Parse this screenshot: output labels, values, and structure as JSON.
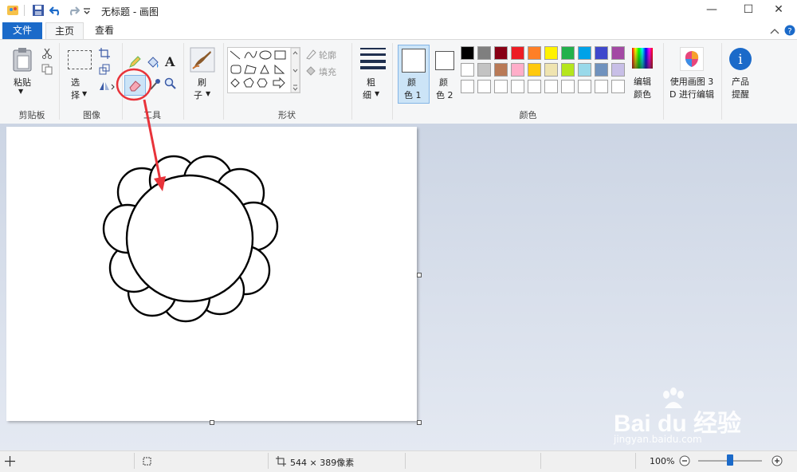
{
  "titlebar": {
    "title": "无标题 - 画图"
  },
  "tabs": {
    "file": "文件",
    "home": "主页",
    "view": "查看"
  },
  "clipboard": {
    "paste": "粘贴",
    "group": "剪贴板"
  },
  "image": {
    "select_1": "选",
    "select_2": "择",
    "group": "图像"
  },
  "tools": {
    "group": "工具"
  },
  "brush": {
    "label_1": "刷",
    "label_2": "子"
  },
  "shapes": {
    "outline": "轮廓",
    "fill": "填充",
    "group": "形状"
  },
  "size": {
    "label_1": "粗",
    "label_2": "细"
  },
  "color1": {
    "label_1": "颜",
    "label_2": "色 1"
  },
  "color2": {
    "label_1": "颜",
    "label_2": "色 2"
  },
  "colors": {
    "group": "颜色",
    "row1": [
      "#000000",
      "#7f7f7f",
      "#880015",
      "#ed1c24",
      "#ff7f27",
      "#fff200",
      "#22b14c",
      "#00a2e8",
      "#3f48cc",
      "#a349a4"
    ],
    "row2": [
      "#ffffff",
      "#c3c3c3",
      "#b97a57",
      "#ffaec9",
      "#ffc90e",
      "#efe4b0",
      "#b5e61d",
      "#99d9ea",
      "#7092be",
      "#c8bfe7"
    ],
    "row3": [
      "#ffffff",
      "#ffffff",
      "#ffffff",
      "#ffffff",
      "#ffffff",
      "#ffffff",
      "#ffffff",
      "#ffffff",
      "#ffffff",
      "#ffffff"
    ]
  },
  "edit_colors": {
    "label_1": "编辑",
    "label_2": "颜色"
  },
  "paint3d": {
    "label_1": "使用画图 3",
    "label_2": "D 进行编辑"
  },
  "product_alert": {
    "label_1": "产品",
    "label_2": "提醒"
  },
  "status": {
    "dimensions": "544 × 389像素",
    "zoom": "100%"
  },
  "watermark": {
    "brand": "Bai du 经验",
    "url": "jingyan.baidu.com"
  },
  "annotation_color": "#e8333a",
  "accent": "#1b6ac9"
}
